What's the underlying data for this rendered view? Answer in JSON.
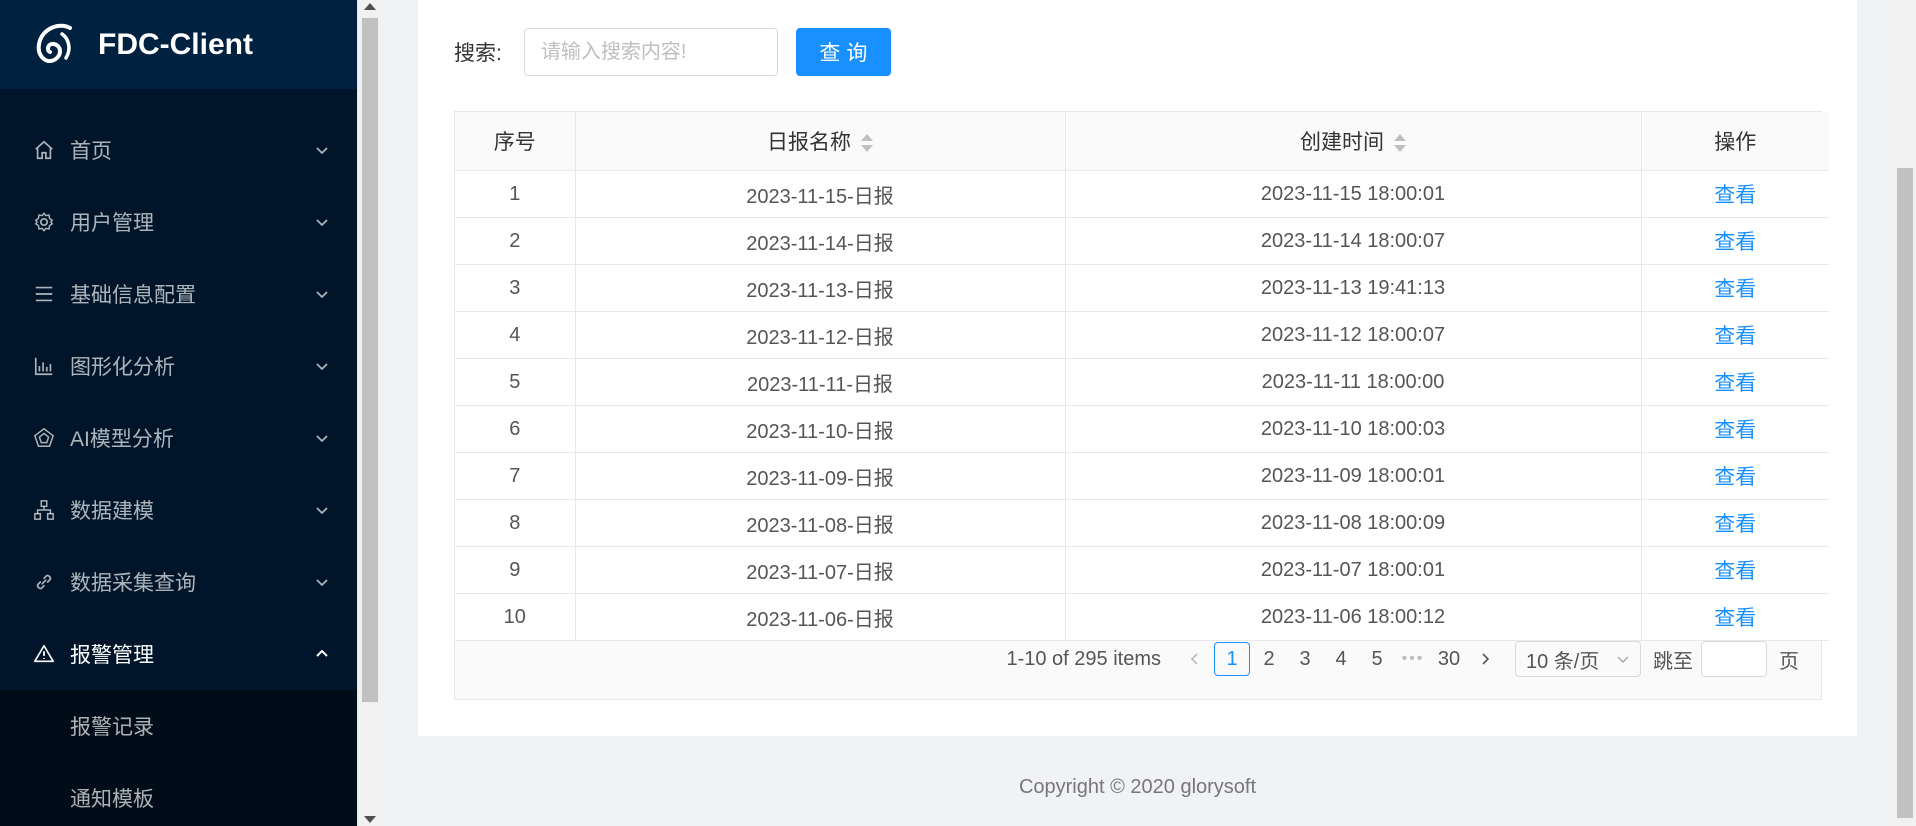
{
  "app": {
    "title": "FDC-Client"
  },
  "sidebar": {
    "items": [
      {
        "label": "首页",
        "icon": "home-icon"
      },
      {
        "label": "用户管理",
        "icon": "gear-icon"
      },
      {
        "label": "基础信息配置",
        "icon": "list-icon"
      },
      {
        "label": "图形化分析",
        "icon": "bar-chart-icon"
      },
      {
        "label": "AI模型分析",
        "icon": "pentagon-icon"
      },
      {
        "label": "数据建模",
        "icon": "cluster-icon"
      },
      {
        "label": "数据采集查询",
        "icon": "link-icon"
      },
      {
        "label": "报警管理",
        "icon": "warning-icon",
        "expanded": true
      }
    ],
    "subitems": [
      {
        "label": "报警记录"
      },
      {
        "label": "通知模板"
      }
    ]
  },
  "search": {
    "label": "搜索:",
    "placeholder": "请输入搜索内容!",
    "value": "",
    "button_label": "查询"
  },
  "table": {
    "columns": [
      "序号",
      "日报名称",
      "创建时间",
      "操作"
    ],
    "rows": [
      {
        "no": "1",
        "name": "2023-11-15-日报",
        "time": "2023-11-15 18:00:01",
        "action": "查看"
      },
      {
        "no": "2",
        "name": "2023-11-14-日报",
        "time": "2023-11-14 18:00:07",
        "action": "查看"
      },
      {
        "no": "3",
        "name": "2023-11-13-日报",
        "time": "2023-11-13 19:41:13",
        "action": "查看"
      },
      {
        "no": "4",
        "name": "2023-11-12-日报",
        "time": "2023-11-12 18:00:07",
        "action": "查看"
      },
      {
        "no": "5",
        "name": "2023-11-11-日报",
        "time": "2023-11-11 18:00:00",
        "action": "查看"
      },
      {
        "no": "6",
        "name": "2023-11-10-日报",
        "time": "2023-11-10 18:00:03",
        "action": "查看"
      },
      {
        "no": "7",
        "name": "2023-11-09-日报",
        "time": "2023-11-09 18:00:01",
        "action": "查看"
      },
      {
        "no": "8",
        "name": "2023-11-08-日报",
        "time": "2023-11-08 18:00:09",
        "action": "查看"
      },
      {
        "no": "9",
        "name": "2023-11-07-日报",
        "time": "2023-11-07 18:00:01",
        "action": "查看"
      },
      {
        "no": "10",
        "name": "2023-11-06-日报",
        "time": "2023-11-06 18:00:12",
        "action": "查看"
      }
    ]
  },
  "pagination": {
    "total_text": "1-10 of 295 items",
    "pages": [
      "1",
      "2",
      "3",
      "4",
      "5"
    ],
    "current": "1",
    "ellipsis": "•••",
    "last_page": "30",
    "page_size": "10 条/页",
    "jump_label": "跳至",
    "jump_value": "",
    "jump_suffix": "页"
  },
  "footer": {
    "text": "Copyright © 2020 glorysoft"
  },
  "colors": {
    "primary": "#1890ff",
    "sidebar_bg": "#001529",
    "logo_bg": "#002140",
    "submenu_bg": "#000c17"
  }
}
